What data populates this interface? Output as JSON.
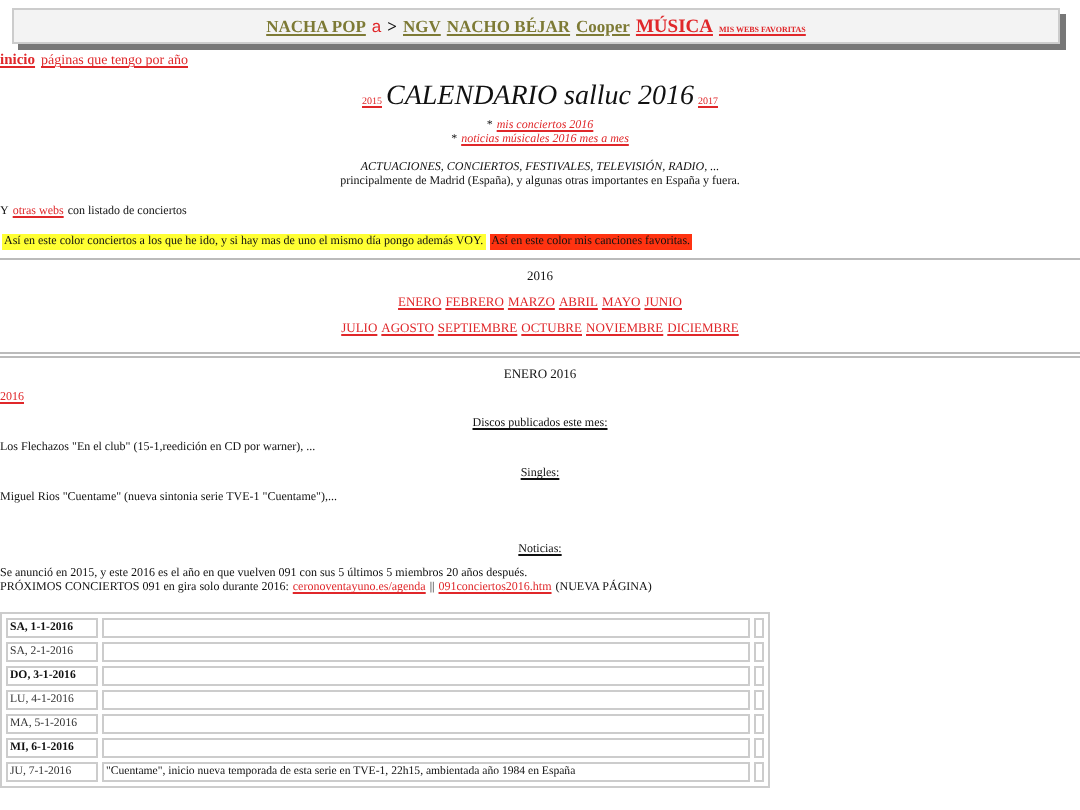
{
  "top_nav": [
    {
      "text": "NACHA POP",
      "kind": "olive"
    },
    {
      "text": "a",
      "kind": "logo"
    },
    {
      "text": ">",
      "kind": "plain"
    },
    {
      "text": "NGV",
      "kind": "olive"
    },
    {
      "text": "NACHO BÉJAR",
      "kind": "olive"
    },
    {
      "text": "Cooper",
      "kind": "olive"
    },
    {
      "text": "MÚSICA",
      "kind": "strong"
    },
    {
      "text": "MIS WEBS FAVORITAS",
      "kind": "small"
    }
  ],
  "breadcrumb": {
    "home": "inicio",
    "link": "páginas que tengo por año"
  },
  "title": {
    "prev": "2015",
    "text": "CALENDARIO salluc 2016",
    "next": "2017"
  },
  "sublinks": [
    {
      "bullet": "*",
      "text": "mis conciertos 2016"
    },
    {
      "bullet": "*",
      "text": "noticias músicales 2016 mes a mes"
    }
  ],
  "intro": {
    "heading": "ACTUACIONES, CONCIERTOS, FESTIVALES, TELEVISIÓN, RADIO, ...",
    "text": "principalmente de Madrid (España), y algunas otras importantes en España y fuera."
  },
  "other_webs": {
    "prefix": "Y",
    "link": "otras webs",
    "suffix": "con listado de conciertos"
  },
  "legend": [
    {
      "text": "Así en este color conciertos a los que he ido, y si hay mas de uno el mismo día pongo además VOY.",
      "color": "#ffff33"
    },
    {
      "text": "Así en este color mis canciones favoritas.",
      "color": "#ff3311"
    }
  ],
  "year": "2016",
  "months_row_1": [
    "ENERO",
    "FEBRERO",
    "MARZO",
    "ABRIL",
    "MAYO",
    "JUNIO"
  ],
  "months_row_2": [
    "JULIO",
    "AGOSTO",
    "SEPTIEMBRE",
    "OCTUBRE",
    "NOVIEMBRE",
    "DICIEMBRE"
  ],
  "month_heading": "ENERO 2016",
  "year_link": "2016",
  "discs": {
    "heading": "Discos publicados este mes:",
    "text": "Los Flechazos \"En el club\" (15-1,reedición en CD por warner), ..."
  },
  "singles": {
    "heading": "Singles:",
    "text": "Miguel Rios \"Cuentame\" (nueva sintonia serie TVE-1 \"Cuentame\"),..."
  },
  "news": {
    "heading": "Noticias:",
    "line_1": "Se anunció en 2015, y este 2016 es el año en que vuelven 091 con sus 5 últimos 5 miembros 20 años después.",
    "line_2_prefix": "PRÓXIMOS CONCIERTOS 091 en gira solo durante 2016:",
    "link_1": "ceronoventayuno.es/agenda",
    "separator": "||",
    "link_2": "091conciertos2016.htm",
    "line_2_suffix": "(NUEVA PÁGINA)"
  },
  "days": [
    {
      "date": "SA, 1-1-2016",
      "bold": true
    },
    {
      "date": "SA, 2-1-2016",
      "bold": false
    },
    {
      "date": "DO, 3-1-2016",
      "bold": true
    },
    {
      "date": "LU, 4-1-2016",
      "bold": false
    },
    {
      "date": "MA, 5-1-2016",
      "bold": false
    },
    {
      "date": "MI, 6-1-2016",
      "bold": true
    },
    {
      "date": "JU, 7-1-2016",
      "bold": false,
      "event": "\"Cuentame\", inicio nueva temporada de esta serie en TVE-1, 22h15, ambientada año 1984 en España"
    }
  ]
}
